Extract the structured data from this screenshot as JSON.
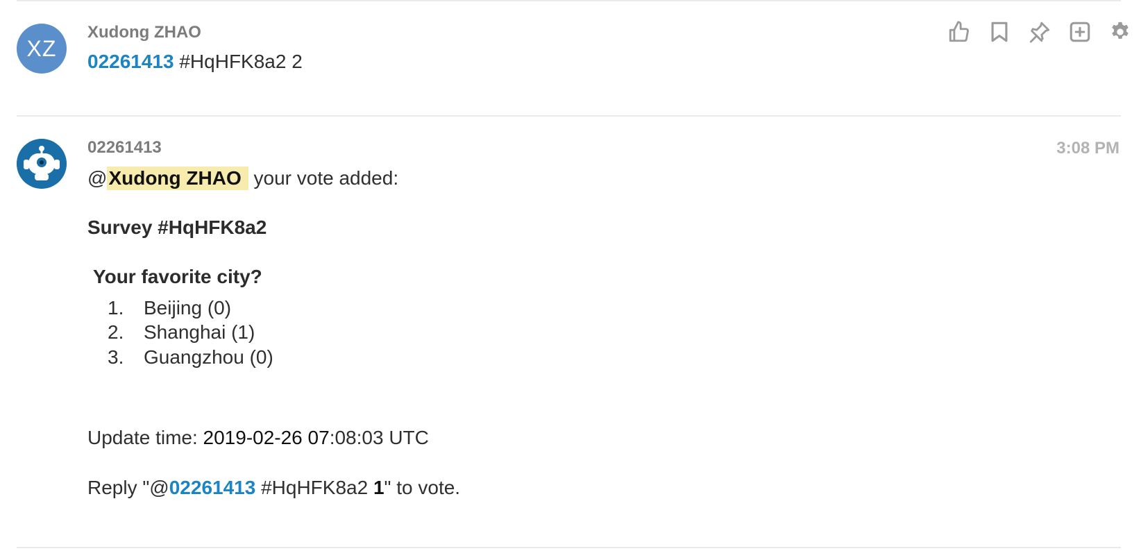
{
  "message1": {
    "avatar_initials": "XZ",
    "avatar_color": "#5b8fcc",
    "sender": "Xudong ZHAO",
    "mention_link": "02261413",
    "text": "#HqHFK8a2 2",
    "actions": [
      "thumbs-up-icon",
      "bookmark-icon",
      "pin-icon",
      "add-icon",
      "gear-icon"
    ]
  },
  "message2": {
    "sender": "02261413",
    "time": "3:08 PM",
    "at_symbol": "@",
    "mention": "Xudong ZHAO",
    "intro": " your vote added:",
    "survey_title": "Survey #HqHFK8a2",
    "question": "Your favorite city?",
    "options": [
      {
        "num": "1.",
        "label": "Beijing (0)"
      },
      {
        "num": "2.",
        "label": "Shanghai (1)"
      },
      {
        "num": "3.",
        "label": "Guangzhou (0)"
      }
    ],
    "update_label": "Update time: ",
    "update_value": "2019-02-26 07",
    "update_value_rest": ":08:03 UTC",
    "reply_prefix": "Reply \"@",
    "reply_link": "02261413",
    "reply_mid": " #HqHFK8a2 ",
    "reply_num": "1",
    "reply_suffix": "\" to vote."
  },
  "colors": {
    "link": "#1b84c4",
    "mention_bg": "#f7ebad",
    "bot_avatar": "#1b6fa8",
    "icon": "#9a9a9a"
  }
}
